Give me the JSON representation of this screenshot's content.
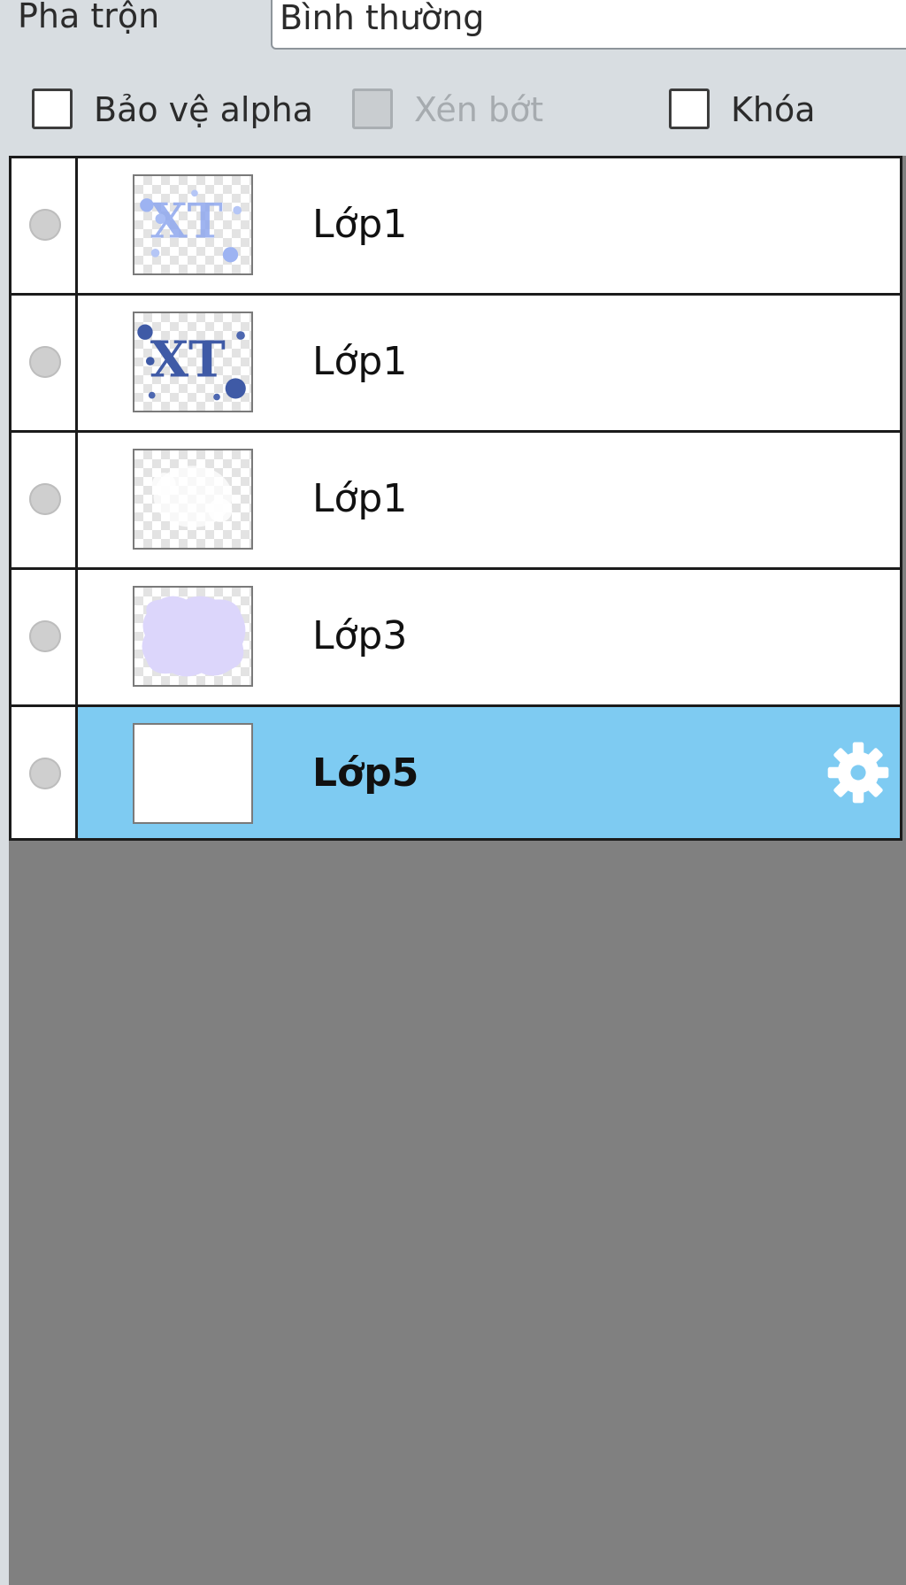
{
  "blend": {
    "label": "Pha trộn",
    "value": "Bình thường"
  },
  "options": {
    "protect_alpha": {
      "label": "Bảo vệ alpha",
      "checked": false,
      "enabled": true
    },
    "clipping": {
      "label": "Xén bớt",
      "checked": false,
      "enabled": false
    },
    "lock": {
      "label": "Khóa",
      "checked": false,
      "enabled": true
    }
  },
  "layers": [
    {
      "name": "Lớp1",
      "selected": false,
      "thumbnail": "light-blue-text-splatter"
    },
    {
      "name": "Lớp1",
      "selected": false,
      "thumbnail": "dark-blue-text-splatter"
    },
    {
      "name": "Lớp1",
      "selected": false,
      "thumbnail": "faint-white-shape"
    },
    {
      "name": "Lớp3",
      "selected": false,
      "thumbnail": "lavender-cloud"
    },
    {
      "name": "Lớp5",
      "selected": true,
      "thumbnail": "blank-white",
      "settings_icon": "gear-icon"
    }
  ],
  "colors": {
    "selected_row": "#7ecbf2",
    "panel_background": "#808080",
    "toolbar_background": "#d8dde1"
  }
}
